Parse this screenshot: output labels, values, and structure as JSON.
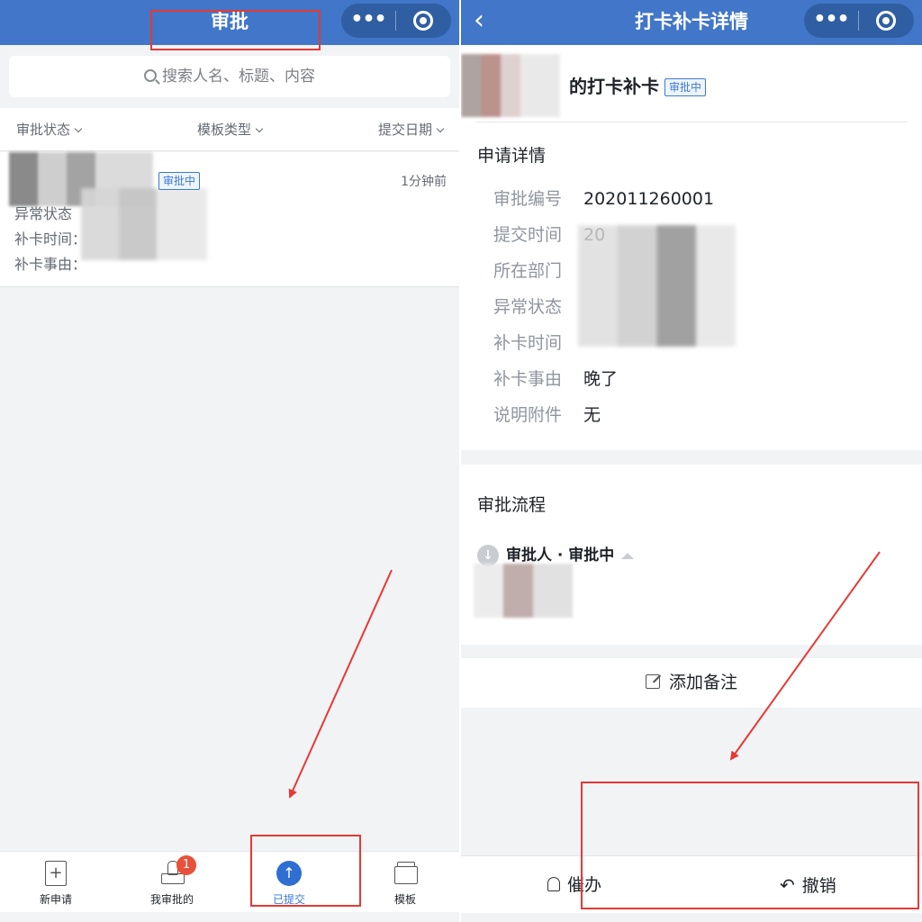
{
  "left": {
    "nav": {
      "title": "审批",
      "more_icon": "•••"
    },
    "search": {
      "placeholder": "搜索人名、标题、内容"
    },
    "filters": {
      "status": "审批状态",
      "template": "模板类型",
      "date": "提交日期"
    },
    "item": {
      "badge": "审批中",
      "time": "1分钟前",
      "fields": [
        "异常状态",
        "补卡时间：",
        "补卡事由："
      ]
    },
    "tabbar": {
      "new_request": "新申请",
      "my_approvals": "我审批的",
      "my_approvals_badge": "1",
      "submitted": "已提交",
      "templates": "模板"
    }
  },
  "right": {
    "nav": {
      "title": "打卡补卡详情",
      "back_icon": "‹",
      "more_icon": "•••"
    },
    "header": {
      "title": "的打卡补卡",
      "badge": "审批中"
    },
    "details": {
      "title": "申请详情",
      "rows": [
        {
          "key": "审批编号",
          "value": "202011260001"
        },
        {
          "key": "提交时间",
          "value": "20"
        },
        {
          "key": "所在部门",
          "value": ""
        },
        {
          "key": "异常状态",
          "value": ""
        },
        {
          "key": "补卡时间",
          "value": ""
        },
        {
          "key": "补卡事由",
          "value": "晚了"
        },
        {
          "key": "说明附件",
          "value": "无"
        }
      ]
    },
    "flow": {
      "title": "审批流程",
      "node": "审批人 · 审批中"
    },
    "add_note": "添加备注",
    "actions": {
      "urge": "催办",
      "revoke": "撤销"
    }
  },
  "colors": {
    "nav_blue": "#4176c8",
    "accent": "#3b7ad4",
    "badge_red": "#e8503a",
    "annotation_red": "#e53935"
  }
}
